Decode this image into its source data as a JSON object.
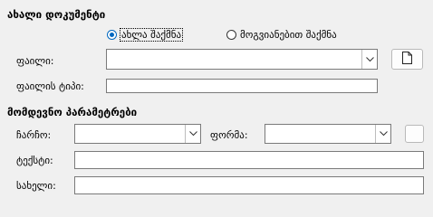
{
  "new_document": {
    "heading": "ახალი დოკუმენტი",
    "radio_new_label": "ახლა შაქმნა",
    "radio_new_selected": true,
    "radio_template_label": "მოგვიანებით შაქმნა",
    "radio_template_selected": false,
    "file_label": "ფაილი:",
    "file_value": "",
    "file_type_label": "ფაილის ტიპი:",
    "file_type_value": "",
    "browse_icon": "file-icon"
  },
  "additional_params": {
    "heading": "მომდევნო პარამეტრები",
    "frame_label": "ჩარჩო:",
    "frame_value": "",
    "form_label": "ფორმა:",
    "form_value": "",
    "text_label": "ტექსტი:",
    "text_value": "",
    "name_label": "სახელი:",
    "name_value": ""
  }
}
